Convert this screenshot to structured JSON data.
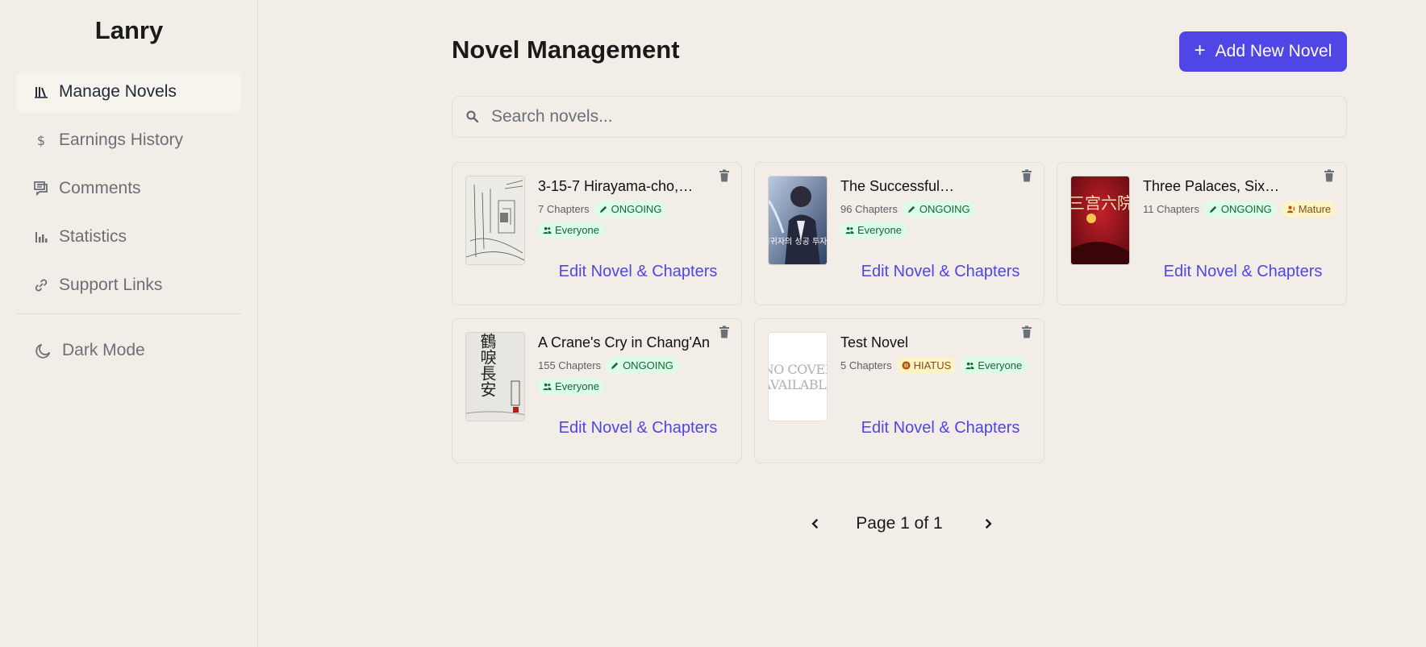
{
  "app": {
    "brand": "Lanry"
  },
  "sidebar": {
    "items": [
      {
        "label": "Manage Novels",
        "icon": "library-icon",
        "active": true
      },
      {
        "label": "Earnings History",
        "icon": "dollar-icon"
      },
      {
        "label": "Comments",
        "icon": "comments-icon"
      },
      {
        "label": "Statistics",
        "icon": "bar-chart-icon"
      },
      {
        "label": "Support Links",
        "icon": "link-icon"
      }
    ],
    "dark_mode_label": "Dark Mode"
  },
  "main": {
    "title": "Novel Management",
    "add_button_label": "Add New Novel",
    "search": {
      "placeholder": "Search novels...",
      "value": ""
    },
    "edit_label": "Edit Novel & Chapters",
    "novels": [
      {
        "title": "3-15-7 Hirayama-cho,…",
        "chapters": "7 Chapters",
        "status": "ONGOING",
        "rating": "Everyone",
        "cover": "sketch"
      },
      {
        "title": "The Successful…",
        "chapters": "96 Chapters",
        "status": "ONGOING",
        "rating": "Everyone",
        "cover": "manhwa",
        "cover_text": "회귀자의 성공 투자법"
      },
      {
        "title": "Three Palaces, Six…",
        "chapters": "11 Chapters",
        "status": "ONGOING",
        "rating": "Mature",
        "cover": "red",
        "cover_text": "三宫六院"
      },
      {
        "title": "A Crane's Cry in Chang'An",
        "chapters": "155 Chapters",
        "status": "ONGOING",
        "rating": "Everyone",
        "cover": "calligraphy",
        "cover_text": "鶴唳長安"
      },
      {
        "title": "Test Novel",
        "chapters": "5 Chapters",
        "status": "HIATUS",
        "rating": "Everyone",
        "cover": "none",
        "cover_text": "NO COVER AVAILABLE"
      }
    ],
    "pagination": {
      "label": "Page 1 of 1"
    }
  },
  "colors": {
    "accent": "#4f46e5",
    "background": "#f2ede6",
    "ongoing": "#dcfce7",
    "hiatus": "#fef3c7"
  }
}
